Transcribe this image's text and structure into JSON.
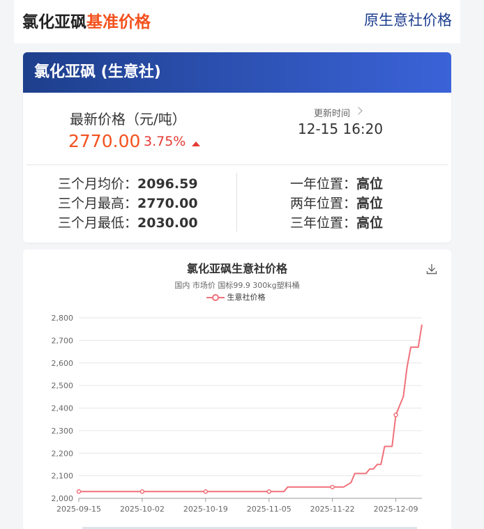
{
  "header": {
    "title_main": "氯化亚砜",
    "title_highlight": "基准价格",
    "right_link": "原生意社价格"
  },
  "summary": {
    "card_title": "氯化亚砜 (生意社)",
    "price_label": "最新价格（元/吨）",
    "price_value": "2770.00",
    "change_pct": "3.75%",
    "update_label": "更新时间",
    "update_time": "12-15 16:20",
    "stats_left": [
      {
        "label": "三个月均价：",
        "value": "2096.59"
      },
      {
        "label": "三个月最高：",
        "value": "2770.00"
      },
      {
        "label": "三个月最低：",
        "value": "2030.00"
      }
    ],
    "stats_right": [
      {
        "label": "一年位置：",
        "value": "高位"
      },
      {
        "label": "两年位置：",
        "value": "高位"
      },
      {
        "label": "三年位置：",
        "value": "高位"
      }
    ],
    "colors": {
      "accent": "#f4511e",
      "up": "#e53935",
      "header_start": "#1e3f8c",
      "header_end": "#3b63d8"
    }
  },
  "chart_data": {
    "type": "line",
    "title": "氯化亚砜生意社价格",
    "subtitle": "国内 市场价 国标99.9  300kg塑料桶",
    "ylim": [
      2000,
      2800
    ],
    "yticks": [
      "2,000",
      "2,100",
      "2,200",
      "2,300",
      "2,400",
      "2,500",
      "2,600",
      "2,700",
      "2,800"
    ],
    "xticks": [
      "2025-09-15",
      "2025-10-02",
      "2025-10-19",
      "2025-11-05",
      "2025-11-22",
      "2025-12-09"
    ],
    "grid": true,
    "legend_position": "top-center",
    "series": [
      {
        "name": "生意社价格",
        "color": "#f0717a",
        "points": [
          [
            "2025-09-15",
            2030
          ],
          [
            "2025-10-02",
            2030
          ],
          [
            "2025-10-19",
            2030
          ],
          [
            "2025-11-05",
            2030
          ],
          [
            "2025-11-09",
            2030
          ],
          [
            "2025-11-10",
            2050
          ],
          [
            "2025-11-22",
            2050
          ],
          [
            "2025-11-25",
            2050
          ],
          [
            "2025-11-27",
            2070
          ],
          [
            "2025-11-28",
            2110
          ],
          [
            "2025-12-01",
            2110
          ],
          [
            "2025-12-02",
            2130
          ],
          [
            "2025-12-03",
            2130
          ],
          [
            "2025-12-04",
            2150
          ],
          [
            "2025-12-05",
            2150
          ],
          [
            "2025-12-06",
            2230
          ],
          [
            "2025-12-08",
            2230
          ],
          [
            "2025-12-09",
            2370
          ],
          [
            "2025-12-10",
            2410
          ],
          [
            "2025-12-11",
            2450
          ],
          [
            "2025-12-12",
            2580
          ],
          [
            "2025-12-13",
            2670
          ],
          [
            "2025-12-15",
            2670
          ],
          [
            "2025-12-16",
            2770
          ]
        ],
        "markers": [
          "2025-09-15",
          "2025-10-02",
          "2025-10-19",
          "2025-11-05",
          "2025-11-22",
          "2025-12-09"
        ]
      }
    ]
  }
}
